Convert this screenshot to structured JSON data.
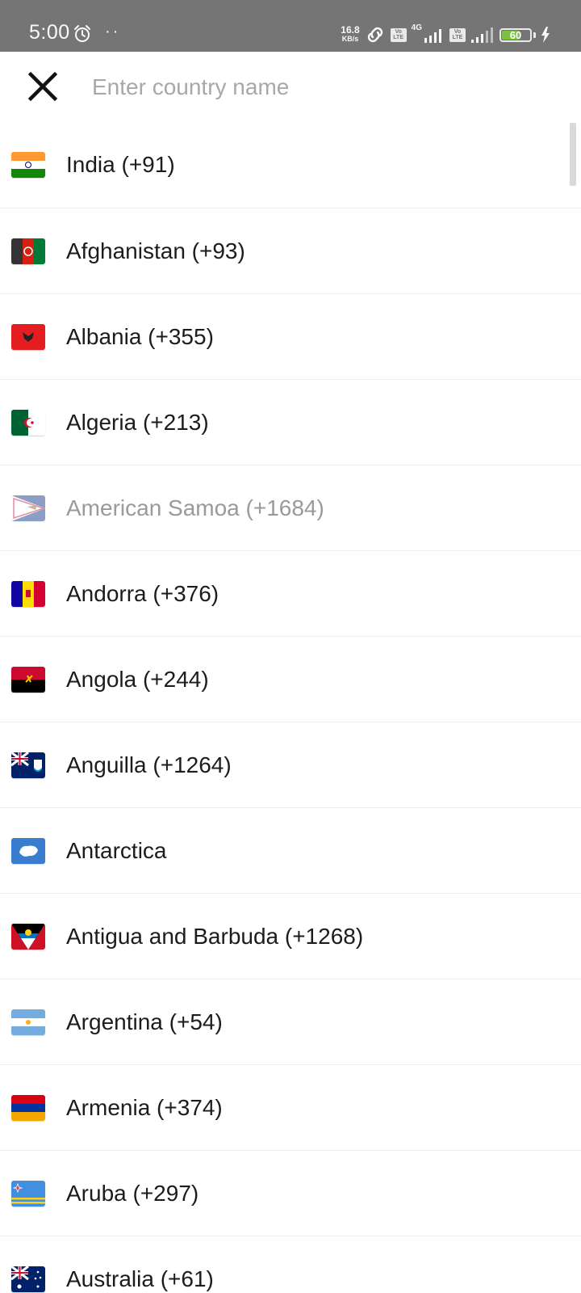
{
  "status_bar": {
    "time": "5:00",
    "dots": "··",
    "net_speed_value": "16.8",
    "net_speed_unit": "KB/s",
    "volte_label_top": "Vo",
    "volte_label_bottom": "LTE",
    "network_type": "4G",
    "battery_level": "60",
    "battery_fraction": 0.6,
    "battery_color": "#7cc142"
  },
  "search": {
    "placeholder": "Enter country name",
    "value": ""
  },
  "countries": [
    {
      "label": "India (+91)",
      "flag": "india-flag"
    },
    {
      "label": "Afghanistan (+93)",
      "flag": "afghanistan-flag"
    },
    {
      "label": "Albania (+355)",
      "flag": "albania-flag"
    },
    {
      "label": "Algeria (+213)",
      "flag": "algeria-flag"
    },
    {
      "label": "American Samoa (+1684)",
      "flag": "american-samoa-flag",
      "disabled": true
    },
    {
      "label": "Andorra (+376)",
      "flag": "andorra-flag"
    },
    {
      "label": "Angola (+244)",
      "flag": "angola-flag"
    },
    {
      "label": "Anguilla (+1264)",
      "flag": "anguilla-flag"
    },
    {
      "label": "Antarctica",
      "flag": "antarctica-flag"
    },
    {
      "label": "Antigua and Barbuda (+1268)",
      "flag": "antigua-and-barbuda-flag"
    },
    {
      "label": "Argentina (+54)",
      "flag": "argentina-flag"
    },
    {
      "label": "Armenia (+374)",
      "flag": "armenia-flag"
    },
    {
      "label": "Aruba (+297)",
      "flag": "aruba-flag"
    },
    {
      "label": "Australia (+61)",
      "flag": "australia-flag"
    }
  ]
}
